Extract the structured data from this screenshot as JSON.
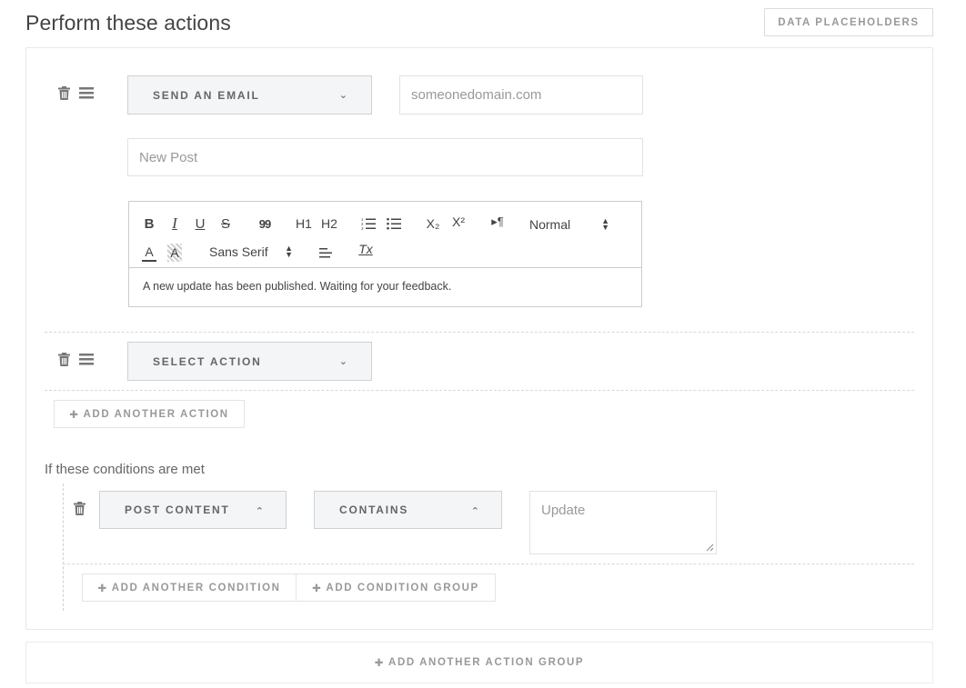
{
  "header": {
    "title": "Perform these actions",
    "placeholders_button": "DATA PLACEHOLDERS"
  },
  "action1": {
    "select_label": "SEND AN EMAIL",
    "chevron": "⌄",
    "email_placeholder": "someonedomain.com",
    "subject_placeholder": "New Post",
    "editor": {
      "bold": "B",
      "italic": "I",
      "underline": "U",
      "strike": "S",
      "quote": "99",
      "h1": "H1",
      "h2": "H2",
      "subscript": "X₂",
      "superscript": "X²",
      "direction": "▸¶",
      "format_select": "Normal",
      "font_select": "Sans Serif",
      "clean": "Tx",
      "body_text": "A new update has been published. Waiting for your feedback."
    }
  },
  "action2": {
    "select_label": "SELECT ACTION",
    "chevron": "⌄"
  },
  "add_action_button": "ADD ANOTHER ACTION",
  "conditions": {
    "heading": "If these conditions are met",
    "field_select": "POST CONTENT",
    "operator_select": "CONTAINS",
    "chevron_up": "⌃",
    "value_placeholder": "Update",
    "add_condition_button": "ADD ANOTHER CONDITION",
    "add_group_button": "ADD CONDITION GROUP"
  },
  "add_action_group_button": "ADD ANOTHER ACTION GROUP",
  "plus_glyph": "✚"
}
